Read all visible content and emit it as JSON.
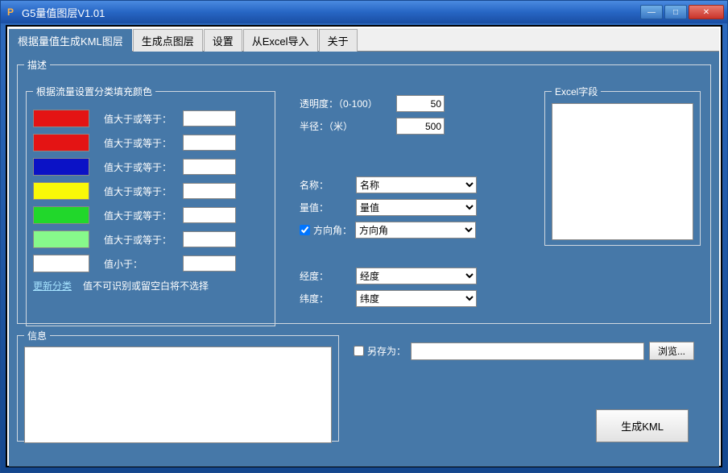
{
  "window": {
    "title": "G5量值图层V1.01"
  },
  "tabs": [
    "根据量值生成KML图层",
    "生成点图层",
    "设置",
    "从Excel导入",
    "关于"
  ],
  "desc": {
    "legend": "描述",
    "colors_legend": "根据流量设置分类填充颜色",
    "rows": [
      {
        "color": "#e41414",
        "label": "值大于或等于："
      },
      {
        "color": "#e41414",
        "label": "值大于或等于："
      },
      {
        "color": "#0b12c6",
        "label": "值大于或等于："
      },
      {
        "color": "#f9f908",
        "label": "值大于或等于："
      },
      {
        "color": "#21d72b",
        "label": "值大于或等于："
      },
      {
        "color": "#87f98b",
        "label": "值大于或等于："
      },
      {
        "color": "#ffffff",
        "label": "值小于："
      }
    ],
    "update_link": "更新分类",
    "note": "值不可识别或留空白将不选择"
  },
  "mid": {
    "opacity_label": "透明度：（0-100）",
    "opacity_value": "50",
    "radius_label": "半径：（米）",
    "radius_value": "500",
    "name_label": "名称：",
    "name_value": "名称",
    "value_label": "量值：",
    "value_value": "量值",
    "dir_label": "方向角：",
    "dir_value": "方向角",
    "dir_checked": true,
    "lon_label": "经度：",
    "lon_value": "经度",
    "lat_label": "纬度：",
    "lat_value": "纬度"
  },
  "excel": {
    "legend": "Excel字段"
  },
  "info": {
    "legend": "信息"
  },
  "save": {
    "checkbox_label": "另存为：",
    "path": "",
    "browse": "浏览..."
  },
  "generate": "生成KML"
}
